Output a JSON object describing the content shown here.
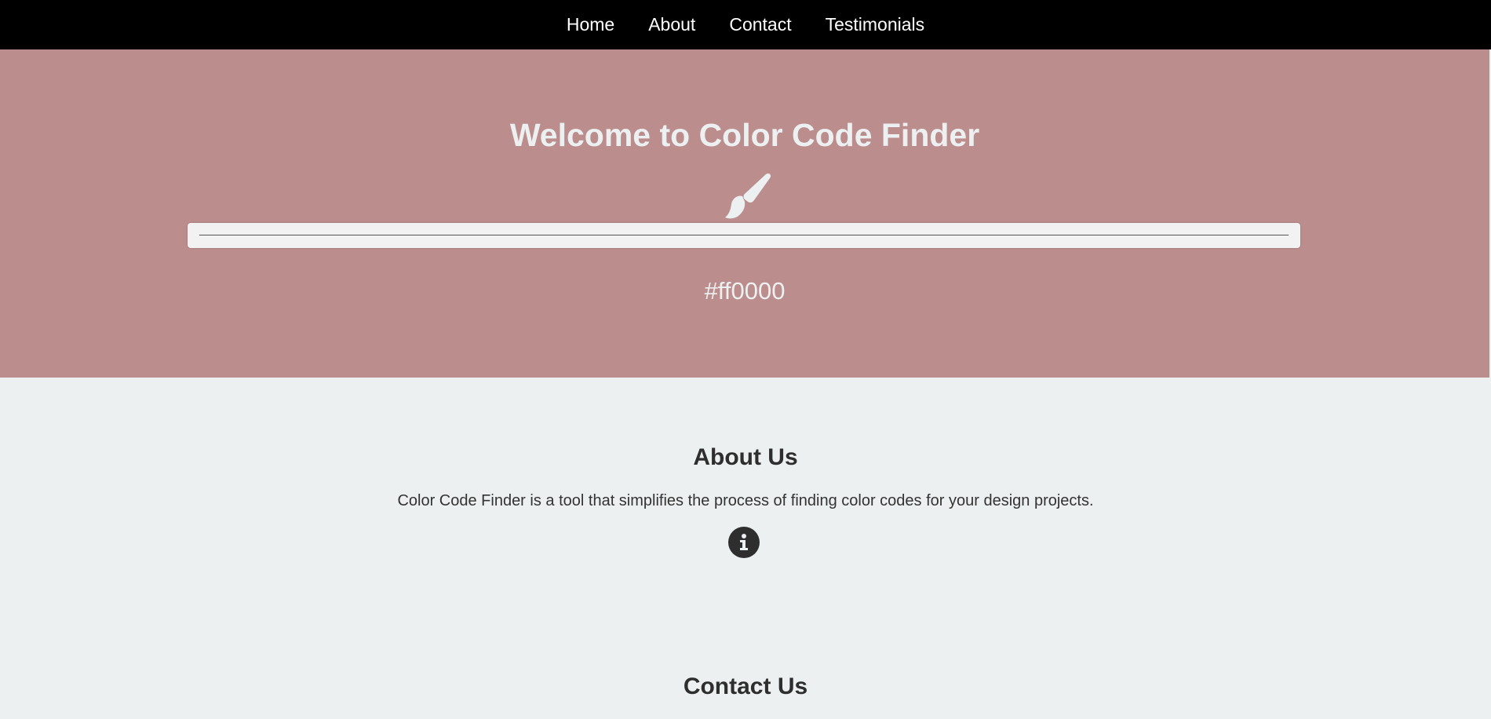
{
  "nav": {
    "items": [
      {
        "label": "Home"
      },
      {
        "label": "About"
      },
      {
        "label": "Contact"
      },
      {
        "label": "Testimonials"
      }
    ]
  },
  "hero": {
    "title": "Welcome to Color Code Finder",
    "icon": "paintbrush-icon",
    "color_value": "#ff0000",
    "hex_display": "#ff0000",
    "background": "#bc8d8d"
  },
  "about": {
    "title": "About Us",
    "text": "Color Code Finder is a tool that simplifies the process of finding color codes for your design projects.",
    "icon": "info-icon"
  },
  "contact": {
    "title": "Contact Us"
  },
  "colors": {
    "nav_bg": "#000000",
    "page_bg": "#ecf0f1",
    "hero_text": "#ecf0f1",
    "heading_text": "#2e2e2e"
  }
}
